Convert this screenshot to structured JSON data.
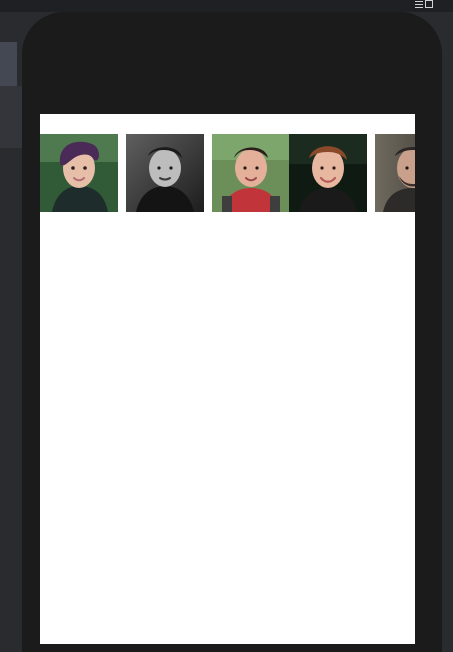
{
  "window": {
    "icons": [
      "menu-lines-icon",
      "window-square-icon"
    ]
  },
  "photo_gallery": {
    "items": [
      {
        "name": "profile-photo-1",
        "subject": "woman-purple-hair"
      },
      {
        "name": "profile-photo-2",
        "subject": "man-black-and-white"
      },
      {
        "name": "profile-photo-3",
        "subject": "man-red-shirt"
      },
      {
        "name": "profile-photo-4",
        "subject": "man-smiling-blond"
      },
      {
        "name": "profile-photo-5",
        "subject": "man-beard-partial"
      }
    ]
  }
}
